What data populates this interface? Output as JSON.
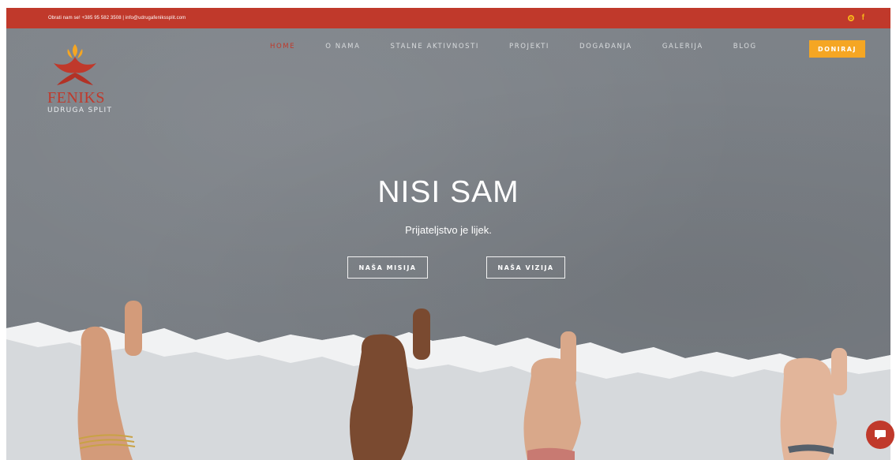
{
  "topbar": {
    "contact": "Obrati nam se! +385 95 582 3508  |  info@udrugafenikssplit.com",
    "social_icons": [
      "instagram-icon",
      "facebook-icon"
    ],
    "facebook_glyph": "f"
  },
  "logo": {
    "name": "FENIKS",
    "subtitle": "UDRUGA SPLIT"
  },
  "nav": {
    "items": [
      {
        "label": "HOME",
        "active": true
      },
      {
        "label": "O NAMA",
        "active": false
      },
      {
        "label": "STALNE AKTIVNOSTI",
        "active": false
      },
      {
        "label": "PROJEKTI",
        "active": false
      },
      {
        "label": "DOGAĐANJA",
        "active": false
      },
      {
        "label": "GALERIJA",
        "active": false
      },
      {
        "label": "BLOG",
        "active": false
      }
    ],
    "donate_label": "DONIRAJ"
  },
  "hero": {
    "title": "NISI SAM",
    "subtitle": "Prijateljstvo je lijek.",
    "mission_button": "NAŠA MISIJA",
    "vision_button": "NAŠA VIZIJA"
  },
  "colors": {
    "brand_red": "#c0392b",
    "accent_orange": "#f5a623",
    "nav_text": "#d9dcde"
  },
  "chat": {
    "icon": "chat-icon"
  }
}
